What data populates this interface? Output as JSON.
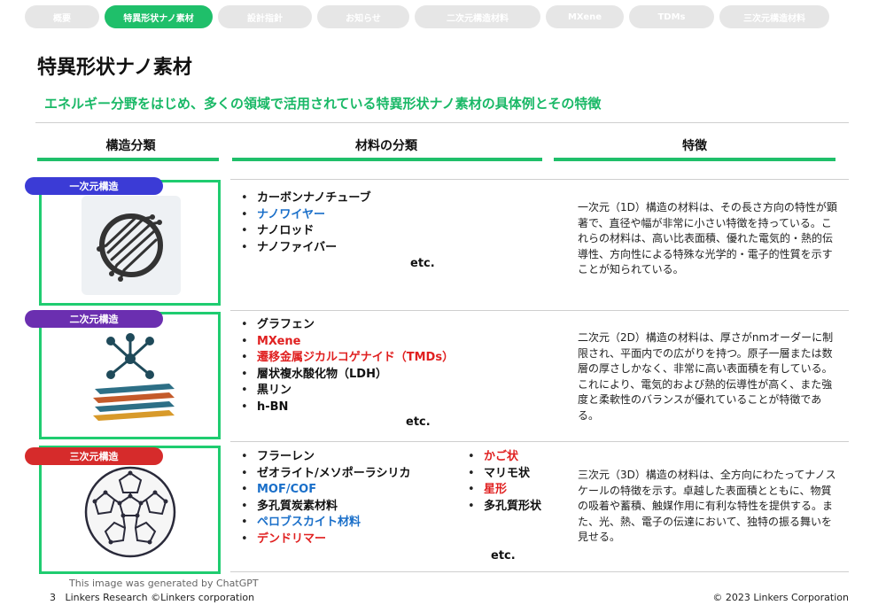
{
  "nav_tabs": [
    {
      "label": "概要",
      "active": false
    },
    {
      "label": "特異形状ナノ素材",
      "active": true
    },
    {
      "label": "設計指針",
      "active": false
    },
    {
      "label": "お知らせ",
      "active": false
    },
    {
      "label": "二次元構造材料",
      "active": false
    },
    {
      "label": "MXene",
      "active": false
    },
    {
      "label": "TDMs",
      "active": false
    },
    {
      "label": "三次元構造材料",
      "active": false
    }
  ],
  "page_title": "特異形状ナノ素材",
  "subtitle": "エネルギー分野をはじめ、多くの領域で活用されている特異形状ナノ素材の具体例とその特徴",
  "columns": {
    "structure": "構造分類",
    "materials": "材料の分類",
    "features": "特徴"
  },
  "rows": {
    "one_d": {
      "badge": "一次元構造",
      "badge_color": "#3b3bd6",
      "materials": [
        {
          "text": "カーボンナノチューブ",
          "color": "black"
        },
        {
          "text": "ナノワイヤー",
          "color": "blue"
        },
        {
          "text": "ナノロッド",
          "color": "black"
        },
        {
          "text": "ナノファイバー",
          "color": "black"
        }
      ],
      "etc": "etc.",
      "feature": "一次元（1D）構造の材料は、その長さ方向の特性が顕著で、直径や幅が非常に小さい特徴を持っている。これらの材料は、高い比表面積、優れた電気的・熱的伝導性、方向性による特殊な光学的・電子的性質を示すことが知られている。"
    },
    "two_d": {
      "badge": "二次元構造",
      "badge_color": "#6b2fb0",
      "materials": [
        {
          "text": "グラフェン",
          "color": "black"
        },
        {
          "text": "MXene",
          "color": "red"
        },
        {
          "text": "遷移金属ジカルコゲナイド（TMDs）",
          "color": "red"
        },
        {
          "text": "層状複水酸化物（LDH）",
          "color": "black"
        },
        {
          "text": "黒リン",
          "color": "black"
        },
        {
          "text": "h-BN",
          "color": "black"
        }
      ],
      "etc": "etc.",
      "feature": "二次元（2D）構造の材料は、厚さがnmオーダーに制限され、平面内での広がりを持つ。原子一層または数層の厚さしかなく、非常に高い表面積を有している。これにより、電気的および熱的伝導性が高く、また強度と柔軟性のバランスが優れていることが特徴である。"
    },
    "three_d": {
      "badge": "三次元構造",
      "badge_color": "#d62b2b",
      "materials_left": [
        {
          "text": "フラーレン",
          "color": "black"
        },
        {
          "text": "ゼオライト/メソポーラシリカ",
          "color": "black"
        },
        {
          "text": "MOF/COF",
          "color": "blue"
        },
        {
          "text": "多孔質炭素材料",
          "color": "black"
        },
        {
          "text": "ペロブスカイト材料",
          "color": "blue"
        },
        {
          "text": "デンドリマー",
          "color": "red"
        }
      ],
      "materials_right": [
        {
          "text": "かご状",
          "color": "red"
        },
        {
          "text": "マリモ状",
          "color": "black"
        },
        {
          "text": "星形",
          "color": "red"
        },
        {
          "text": "多孔質形状",
          "color": "black"
        }
      ],
      "etc": "etc.",
      "feature": "三次元（3D）構造の材料は、全方向にわたってナノスケールの特徴を示す。卓越した表面積とともに、物質の吸着や蓄積、触媒作用に有利な特性を提供する。また、光、熱、電子の伝達において、独特の振る舞いを見せる。"
    }
  },
  "image_credit": "This image was generated by ChatGPT",
  "footer": {
    "page": "3",
    "left": "Linkers Research ©Linkers corporation",
    "right": "© 2023 Linkers Corporation"
  },
  "colors": {
    "accent": "#1fbf6a",
    "blue": "#1a6fc9",
    "red": "#e02020"
  }
}
